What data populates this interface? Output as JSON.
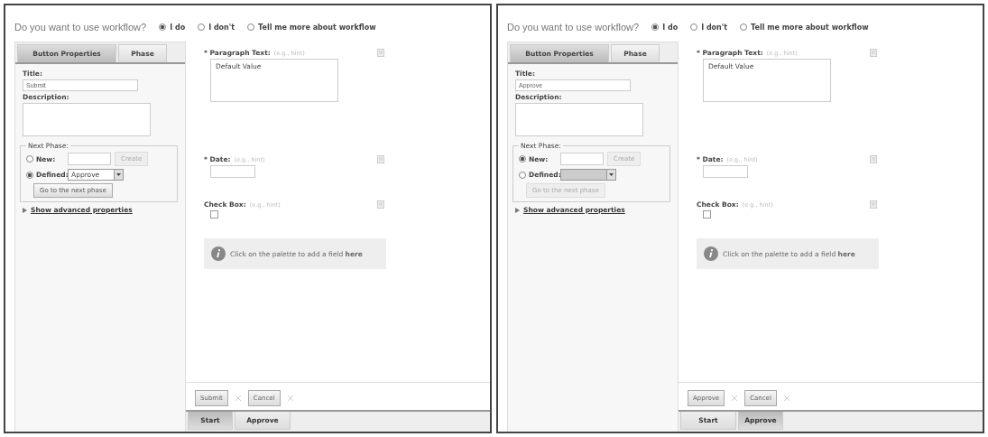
{
  "panels": [
    {
      "question": "Do you want to use workflow?",
      "workflow_options": [
        {
          "label": "I do",
          "selected": true
        },
        {
          "label": "I don't",
          "selected": false
        },
        {
          "label": "Tell me more about workflow",
          "selected": false
        }
      ],
      "tabs": [
        {
          "label": "Button Properties",
          "selected": true
        },
        {
          "label": "Phase",
          "selected": false
        }
      ],
      "title_label": "Title:",
      "title_value": "Submit",
      "description_label": "Description:",
      "next_phase": {
        "legend": "Next Phase:",
        "new_label": "New:",
        "new_selected": false,
        "create": {
          "label": "Create",
          "disabled": true
        },
        "defined_label": "Defined:",
        "defined_selected": true,
        "defined_value": "Approve",
        "defined_disabled": false,
        "go": {
          "label": "Go to the next phase",
          "disabled": false
        }
      },
      "advanced_link": "Show advanced properties",
      "fields": [
        {
          "kind": "textarea",
          "label": "* Paragraph Text:",
          "hint": "(e.g., hint)",
          "value": "Default Value"
        },
        {
          "kind": "date",
          "label": "* Date:",
          "hint": "(e.g., hint)"
        },
        {
          "kind": "checkbox",
          "label": "Check Box:",
          "hint": "(e.g., hint)",
          "checked": false
        }
      ],
      "info": "Click on the palette to add a field **here**",
      "actions": [
        "Submit",
        "Cancel"
      ],
      "phases": [
        {
          "label": "Start",
          "selected": true
        },
        {
          "label": "Approve",
          "selected": false
        }
      ]
    },
    {
      "question": "Do you want to use workflow?",
      "workflow_options": [
        {
          "label": "I do",
          "selected": true
        },
        {
          "label": "I don't",
          "selected": false
        },
        {
          "label": "Tell me more about workflow",
          "selected": false
        }
      ],
      "tabs": [
        {
          "label": "Button Properties",
          "selected": true
        },
        {
          "label": "Phase",
          "selected": false
        }
      ],
      "title_label": "Title:",
      "title_value": "Approve",
      "description_label": "Description:",
      "next_phase": {
        "legend": "Next Phase:",
        "new_label": "New:",
        "new_selected": true,
        "create": {
          "label": "Create",
          "disabled": true
        },
        "defined_label": "Defined:",
        "defined_selected": false,
        "defined_disabled": true,
        "go": {
          "label": "Go to the next phase",
          "disabled": true
        }
      },
      "advanced_link": "Show advanced properties",
      "fields": [
        {
          "kind": "textarea",
          "label": "* Paragraph Text:",
          "hint": "(e.g., hint)",
          "value": "Default Value"
        },
        {
          "kind": "date",
          "label": "* Date:",
          "hint": "(e.g., hint)"
        },
        {
          "kind": "checkbox",
          "label": "Check Box:",
          "hint": "(e.g., hint)",
          "checked": false
        }
      ],
      "info": "Click on the palette to add a field **here**",
      "actions": [
        "Approve",
        "Cancel"
      ],
      "phases": [
        {
          "label": "Start",
          "selected": false
        },
        {
          "label": "Approve",
          "selected": true
        }
      ]
    }
  ]
}
